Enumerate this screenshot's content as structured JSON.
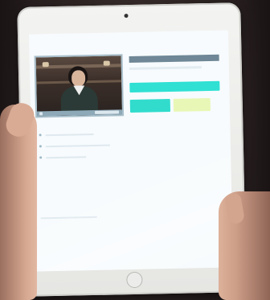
{
  "tablet": {
    "status_text": "",
    "app": {
      "title": "",
      "top_bar_label": "",
      "primary_button_label": "",
      "secondary_button_label": ""
    }
  },
  "colors": {
    "accent_cyan": "#2fe0d3",
    "accent_yellow": "#e9f7b6",
    "bar_slate": "#6f8796"
  },
  "icons": [
    "camera-icon",
    "home-button"
  ]
}
